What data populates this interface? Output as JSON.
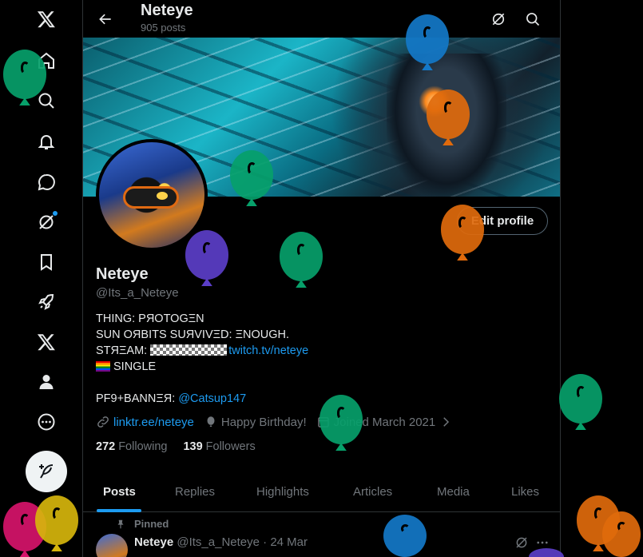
{
  "nav": {
    "items": [
      {
        "name": "x-logo",
        "icon": "x-logo-icon"
      },
      {
        "name": "home",
        "icon": "home-icon"
      },
      {
        "name": "explore",
        "icon": "search-icon"
      },
      {
        "name": "notifications",
        "icon": "bell-icon"
      },
      {
        "name": "messages",
        "icon": "message-icon"
      },
      {
        "name": "grok",
        "icon": "grok-icon"
      },
      {
        "name": "bookmarks",
        "icon": "bookmark-icon"
      },
      {
        "name": "jobs",
        "icon": "rocket-icon"
      },
      {
        "name": "premium",
        "icon": "x-icon"
      },
      {
        "name": "profile",
        "icon": "person-icon"
      },
      {
        "name": "more",
        "icon": "more-circle-icon"
      }
    ],
    "post_button_icon": "feather-plus-icon"
  },
  "header": {
    "title": "Neteye",
    "subtitle": "905 posts"
  },
  "profile": {
    "edit_button": "Edit profile",
    "name": "Neteye",
    "handle": "@Its_a_Neteye",
    "bio": {
      "line1": "THING: PЯOTOGΞN",
      "line2": "SUN OЯBITS SUЯVIVΞD: ΞNOUGH.",
      "line3_prefix": "STЯΞAM: ",
      "line3_link": "twitch.tv/neteye",
      "line4": "SINGLE",
      "line5_prefix": "PF9+BANNΞЯ: ",
      "line5_link": "@Catsup147"
    },
    "website": "linktr.ee/neteye",
    "birthday": "Happy Birthday!",
    "joined": "Joined March 2021",
    "following_count": "272",
    "following_label": "Following",
    "followers_count": "139",
    "followers_label": "Followers"
  },
  "tabs": [
    "Posts",
    "Replies",
    "Highlights",
    "Articles",
    "Media",
    "Likes"
  ],
  "active_tab": "Posts",
  "pinned_post": {
    "pinned_label": "Pinned",
    "author": "Neteye",
    "handle": "@Its_a_Neteye",
    "date": "· 24 Mar"
  },
  "colors": {
    "accent": "#1d9bf0",
    "balloon_green": "#07a06a",
    "balloon_blue": "#1478c8",
    "balloon_orange": "#e06a0c",
    "balloon_purple": "#5b3ec8",
    "balloon_pink": "#d6136a",
    "balloon_yellow": "#d6b50c"
  }
}
